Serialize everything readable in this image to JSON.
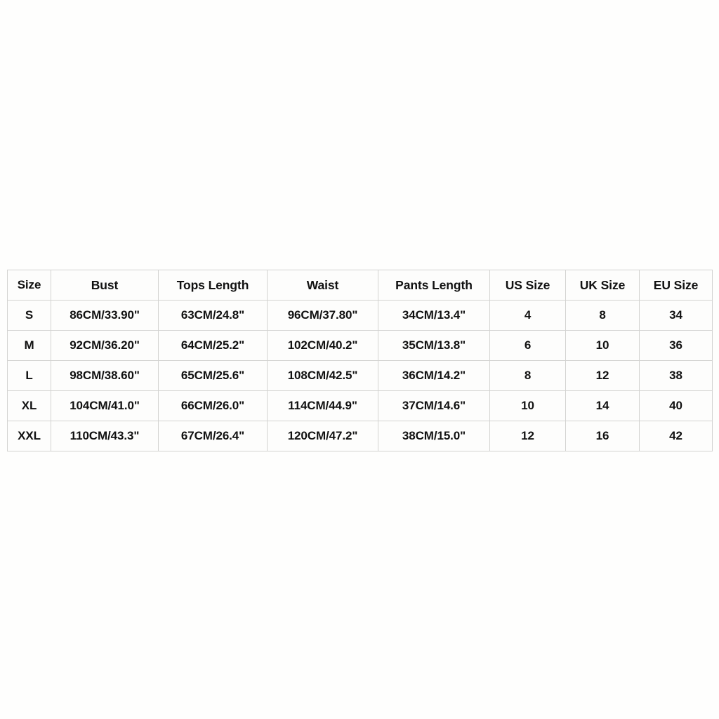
{
  "table": {
    "name": "size-chart",
    "columns": [
      {
        "key": "size",
        "label": "Size"
      },
      {
        "key": "bust",
        "label": "Bust"
      },
      {
        "key": "tops",
        "label": "Tops Length"
      },
      {
        "key": "waist",
        "label": "Waist"
      },
      {
        "key": "pants",
        "label": "Pants Length"
      },
      {
        "key": "us",
        "label": "US Size"
      },
      {
        "key": "uk",
        "label": "UK Size"
      },
      {
        "key": "eu",
        "label": "EU Size"
      }
    ],
    "rows": [
      {
        "size": "S",
        "bust": "86CM/33.90\"",
        "tops": "63CM/24.8\"",
        "waist": "96CM/37.80\"",
        "pants": "34CM/13.4\"",
        "us": "4",
        "uk": "8",
        "eu": "34"
      },
      {
        "size": "M",
        "bust": "92CM/36.20\"",
        "tops": "64CM/25.2\"",
        "waist": "102CM/40.2\"",
        "pants": "35CM/13.8\"",
        "us": "6",
        "uk": "10",
        "eu": "36"
      },
      {
        "size": "L",
        "bust": "98CM/38.60\"",
        "tops": "65CM/25.6\"",
        "waist": "108CM/42.5\"",
        "pants": "36CM/14.2\"",
        "us": "8",
        "uk": "12",
        "eu": "38"
      },
      {
        "size": "XL",
        "bust": "104CM/41.0\"",
        "tops": "66CM/26.0\"",
        "waist": "114CM/44.9\"",
        "pants": "37CM/14.6\"",
        "us": "10",
        "uk": "14",
        "eu": "40"
      },
      {
        "size": "XXL",
        "bust": "110CM/43.3\"",
        "tops": "67CM/26.4\"",
        "waist": "120CM/47.2\"",
        "pants": "38CM/15.0\"",
        "us": "12",
        "uk": "16",
        "eu": "42"
      }
    ]
  },
  "colors": {
    "page_background": "#fefefd",
    "cell_background": "#fdfdfc",
    "border": "#d3d3d1",
    "text": "#111111"
  }
}
